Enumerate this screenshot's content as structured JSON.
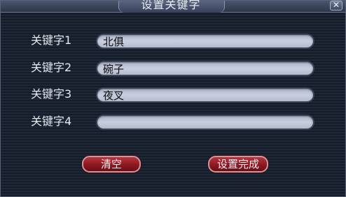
{
  "window": {
    "title": "设置关键字",
    "close_symbol": "✕"
  },
  "keywords": [
    {
      "label": "关键字1",
      "value": "北俱"
    },
    {
      "label": "关键字2",
      "value": "碗子"
    },
    {
      "label": "关键字3",
      "value": "夜叉"
    },
    {
      "label": "关键字4",
      "value": ""
    }
  ],
  "buttons": {
    "clear_label": "清空",
    "finish_label": "设置完成"
  },
  "colors": {
    "background": "#1d2633",
    "field": "#c0c6d6",
    "button": "#8c1820",
    "text": "#e4e8f0"
  },
  "icons": {
    "close": "close-icon"
  }
}
